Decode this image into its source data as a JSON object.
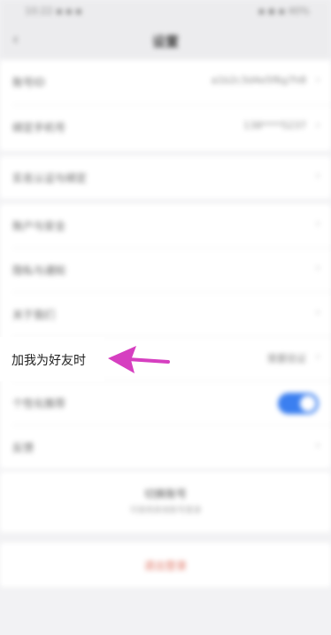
{
  "status_bar": {
    "left": "10:22 ▪ ▪ ▪",
    "right": "▪ ◆ ▪ 40%"
  },
  "nav": {
    "back_icon": "‹",
    "title": "设置"
  },
  "rows": [
    {
      "label": "账号ID",
      "value": "a1b2c3d4e5f6g7h8",
      "type": "chevron"
    },
    {
      "label": "绑定手机号",
      "value": "138****5237",
      "type": "chevron"
    },
    {
      "label": "实名认证与绑定",
      "value": "",
      "type": "chevron"
    },
    {
      "label": "账户与安全",
      "value": "",
      "type": "chevron"
    },
    {
      "label": "隐私与通知",
      "value": "",
      "type": "chevron"
    },
    {
      "label": "关于我们",
      "value": "",
      "type": "chevron"
    },
    {
      "label": "加我为好友时",
      "value": "需要验证",
      "type": "chevron"
    },
    {
      "label": "个性化推荐",
      "value": "",
      "type": "toggle",
      "on": true
    },
    {
      "label": "反馈",
      "value": "",
      "type": "chevron"
    }
  ],
  "switch_account": {
    "label": "切换账号",
    "sub": "可使用其他账号登录"
  },
  "logout": {
    "label": "退出登录"
  },
  "highlight": {
    "label": "加我为好友时"
  },
  "colors": {
    "arrow": "#d63fc0",
    "toggle_on": "#3b7ff0"
  }
}
